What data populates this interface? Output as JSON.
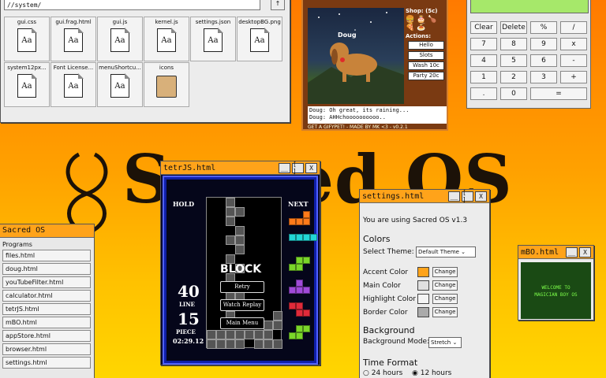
{
  "desktop": {
    "title": "Sacred OS",
    "accent": "#ffa31a"
  },
  "file_browser": {
    "path": "//system/",
    "up_label": "↑",
    "files": [
      {
        "name": "gui.css",
        "type": "doc"
      },
      {
        "name": "gui.frag.html",
        "type": "doc"
      },
      {
        "name": "gui.js",
        "type": "doc"
      },
      {
        "name": "kernel.js",
        "type": "doc"
      },
      {
        "name": "settings.json",
        "type": "doc"
      },
      {
        "name": "desktopBG.png",
        "type": "doc"
      },
      {
        "name": "system12px...",
        "type": "doc"
      },
      {
        "name": "Font License...",
        "type": "doc"
      },
      {
        "name": "menuShortcu...",
        "type": "doc"
      },
      {
        "name": "icons",
        "type": "folder"
      }
    ],
    "doc_glyph": "Aa"
  },
  "doug": {
    "pet_name": "Doug",
    "shop": "Shop: (5c)",
    "actions": "Actions:",
    "buttons": [
      "Hello",
      "Slots",
      "Wash 10c",
      "Party 20c"
    ],
    "log": [
      "Doug: Oh great, its raining...",
      "Doug: AHHchoooooooooo.."
    ],
    "footer": "GET A GIFYPET! - MADE BY MK <3 - v0.2.1"
  },
  "calculator": {
    "buttons": [
      "Clear",
      "Delete",
      "%",
      "/",
      "7",
      "8",
      "9",
      "x",
      "4",
      "5",
      "6",
      "-",
      "1",
      "2",
      "3",
      "+",
      ".",
      "0",
      "="
    ]
  },
  "tetris": {
    "title": "tetrJS.html",
    "hold": "HOLD",
    "next": "NEXT",
    "block": "BLOCK",
    "line_count": "40",
    "line_label": "LINE",
    "piece_count": "15",
    "piece_label": "PIECE",
    "time": "02:29.12",
    "buttons": [
      "Retry",
      "Watch Replay",
      "Main Menu"
    ],
    "next_colors": [
      "#ff7a1a",
      "#22d6d6",
      "#7ad62a",
      "#a04ad8",
      "#e02a3a",
      "#7ad62a"
    ]
  },
  "settings": {
    "title": "settings.html",
    "version_text": "You are using Sacred OS v1.3",
    "colors_heading": "Colors",
    "theme_label": "Select Theme:",
    "theme_value": "Default Theme ⌄",
    "color_rows": [
      {
        "label": "Accent Color",
        "color": "#ffa31a"
      },
      {
        "label": "Main Color",
        "color": "#e0e0e0"
      },
      {
        "label": "Highlight Color",
        "color": "#f4f4f4"
      },
      {
        "label": "Border Color",
        "color": "#aaaaaa"
      }
    ],
    "change_label": "Change",
    "background_heading": "Background",
    "bg_mode_label": "Background Mode:",
    "bg_mode_value": "Stretch ⌄",
    "time_heading": "Time Format",
    "opt_24": "24 hours",
    "opt_12": "12 hours"
  },
  "mbo": {
    "title": "mBO.html",
    "line1": "WELCOME TO",
    "line2": "MAGICIAN BOY OS"
  },
  "launcher": {
    "title": "Sacred OS",
    "section": "Programs",
    "items": [
      "files.html",
      "doug.html",
      "youTubeFilter.html",
      "calculator.html",
      "tetrJS.html",
      "mBO.html",
      "appStore.html",
      "browser.html",
      "settings.html"
    ]
  },
  "window_buttons": {
    "min": "__",
    "max": "[ ]",
    "close": "X"
  }
}
